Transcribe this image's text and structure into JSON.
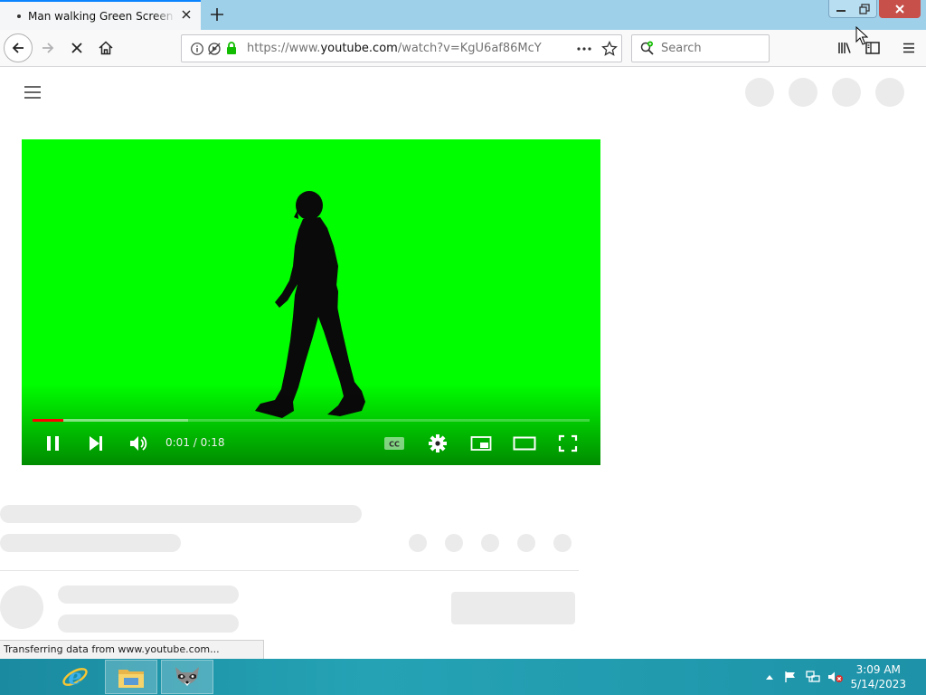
{
  "browser": {
    "tab_title": "Man walking Green Screen background",
    "url_scheme_host": "https://www.",
    "url_domain": "youtube.com",
    "url_path": "/watch?v=KgU6af86McY",
    "search_placeholder": "Search",
    "status_text": "Transferring data from www.youtube.com...",
    "accent_color": "#0a84ff"
  },
  "player": {
    "current_time": "0:01",
    "duration": "0:18",
    "time_display": "0:01 / 0:18",
    "played_fraction": 0.055,
    "buffered_fraction": 0.28,
    "background_color": "#00fe00"
  },
  "taskbar": {
    "time": "3:09 AM",
    "date": "5/14/2023",
    "apps": [
      "internet-explorer",
      "file-explorer",
      "firefox-raccoon"
    ]
  }
}
